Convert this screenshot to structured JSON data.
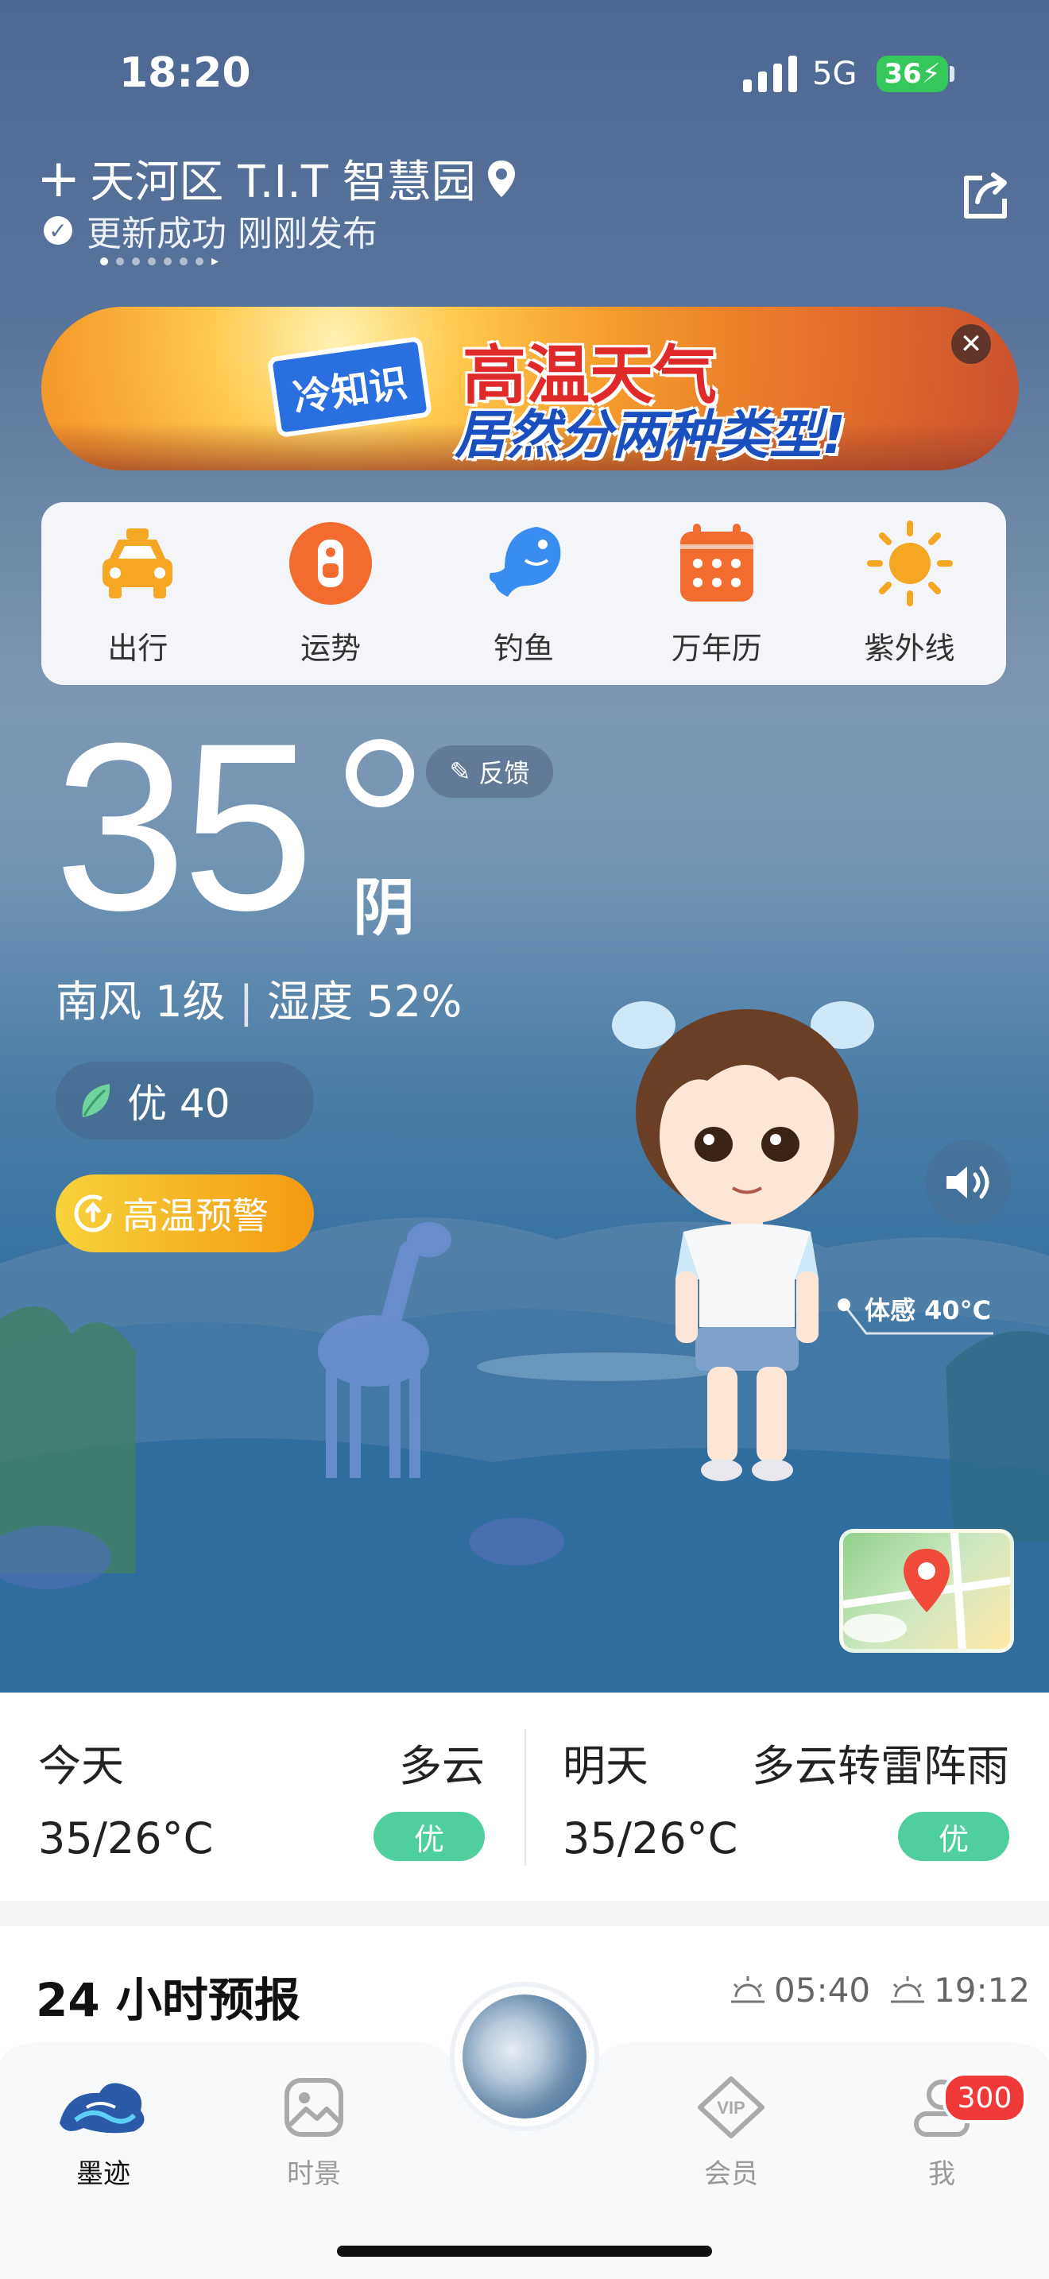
{
  "status_bar": {
    "time": "18:20",
    "network": "5G",
    "battery": "36"
  },
  "location": {
    "add_symbol": "+",
    "name": "天河区 T.I.T 智慧园",
    "update_status": "更新成功 刚刚发布",
    "page_count": 8
  },
  "banner": {
    "tag": "冷知识",
    "line1": "高温天气",
    "line2": "居然分两种类型!"
  },
  "quick_tools": [
    {
      "label": "出行",
      "icon": "taxi-icon",
      "color": "#f5a623"
    },
    {
      "label": "运势",
      "icon": "fortune-icon",
      "color": "#f26b2f"
    },
    {
      "label": "钓鱼",
      "icon": "fish-icon",
      "color": "#3a8df0"
    },
    {
      "label": "万年历",
      "icon": "calendar-icon",
      "color": "#f26b2f"
    },
    {
      "label": "紫外线",
      "icon": "sun-icon",
      "color": "#f5a623"
    }
  ],
  "current": {
    "temperature": "35",
    "condition": "阴",
    "feedback_label": "反馈",
    "wind": "南风 1级",
    "humidity": "湿度 52%",
    "aqi_label": "优 40",
    "warning": "高温预警",
    "feels_like": "体感 40°C"
  },
  "forecast": [
    {
      "day": "今天",
      "condition": "多云",
      "temp": "35/26°C",
      "aqi": "优"
    },
    {
      "day": "明天",
      "condition": "多云转雷阵雨",
      "temp": "35/26°C",
      "aqi": "优"
    }
  ],
  "hourly": {
    "title": "24 小时预报",
    "sunrise": "05:40",
    "sunset": "19:12"
  },
  "tabbar": {
    "items": [
      {
        "label": "墨迹",
        "active": true
      },
      {
        "label": "时景",
        "active": false
      },
      {
        "label": "会员",
        "active": false
      },
      {
        "label": "我",
        "active": false
      }
    ],
    "badge": "300"
  },
  "colors": {
    "accent_green": "#4fcf9e",
    "warning_orange": "#f39a12",
    "badge_red": "#f03a3a"
  }
}
